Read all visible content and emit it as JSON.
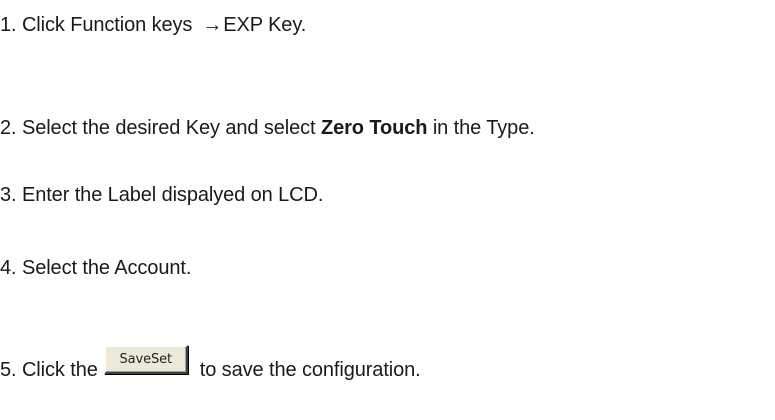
{
  "steps": [
    {
      "number": "1.",
      "text_before": "Click Function keys",
      "arrow": "→",
      "text_after": "EXP Key."
    },
    {
      "number": "2.",
      "text_before": "Select the desired Key and select",
      "bold": "Zero Touch",
      "text_after": "in the Type."
    },
    {
      "number": "3.",
      "text": "Enter the Label dispalyed on LCD."
    },
    {
      "number": "4.",
      "text": "Select the Account."
    },
    {
      "number": "5.",
      "text_before": "Click the",
      "button_label": "SaveSet",
      "text_after": "to save the configuration."
    }
  ]
}
